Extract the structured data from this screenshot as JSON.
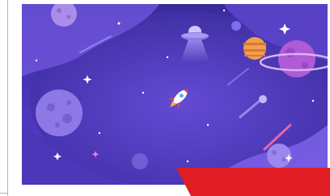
{
  "illustration": {
    "subject": "space-scene",
    "elements": [
      "planet-icon",
      "ufo-icon",
      "rocket-icon",
      "ringed-planet-icon",
      "comet-icon",
      "star-icon"
    ]
  },
  "colors": {
    "rule": "#d9a3a3",
    "sky_dark": "#3b2a9e",
    "sky_light": "#6a4fd6",
    "nebula": "#8a6cf0",
    "accent_red": "#e01e24",
    "planet_orange": "#f0a04a",
    "planet_purple": "#b05ad8"
  }
}
